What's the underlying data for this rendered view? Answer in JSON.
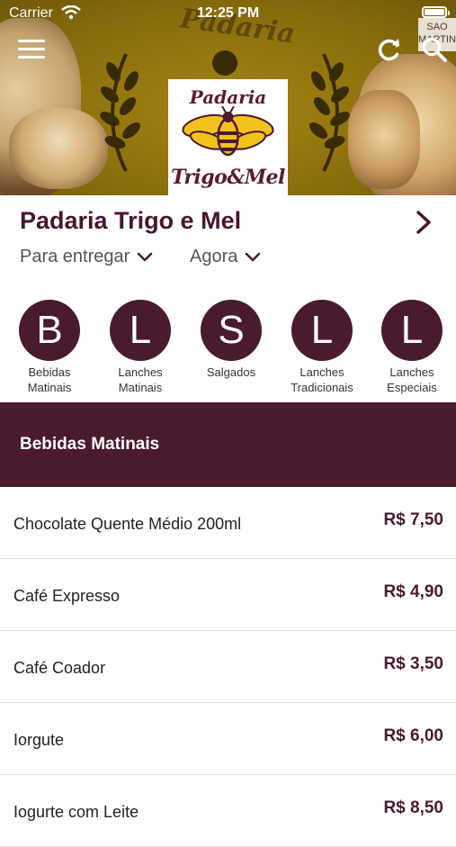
{
  "status_bar": {
    "carrier": "Carrier",
    "time": "12:25 PM"
  },
  "hero": {
    "background_word": "Padaria",
    "sign_lines": [
      "SAO",
      "MARTIN"
    ]
  },
  "logo": {
    "line1": "Padaria",
    "line2": "Trigo&Mel"
  },
  "store": {
    "name": "Padaria Trigo e Mel",
    "delivery_mode": "Para entregar",
    "schedule": "Agora"
  },
  "categories": [
    {
      "letter": "B",
      "label_lines": [
        "Bebidas",
        "Matinais"
      ]
    },
    {
      "letter": "L",
      "label_lines": [
        "Lanches",
        "Matinais"
      ]
    },
    {
      "letter": "S",
      "label_lines": [
        "Salgados",
        ""
      ]
    },
    {
      "letter": "L",
      "label_lines": [
        "Lanches",
        "Tradicionais"
      ]
    },
    {
      "letter": "L",
      "label_lines": [
        "Lanches",
        "Especiais"
      ]
    }
  ],
  "section": {
    "title": "Bebidas Matinais"
  },
  "items": [
    {
      "name": "Chocolate Quente Médio 200ml",
      "price": "R$ 7,50"
    },
    {
      "name": "Café Expresso",
      "price": "R$ 4,90"
    },
    {
      "name": "Café Coador",
      "price": "R$ 3,50"
    },
    {
      "name": "Iorgute",
      "price": "R$ 6,00"
    },
    {
      "name": "Iogurte com Leite",
      "price": "R$ 8,50"
    }
  ],
  "colors": {
    "brand": "#4a1a2f",
    "hero_gold": "#8a6e0c",
    "bee_yellow": "#f2c21b"
  },
  "icons": [
    "wifi-icon",
    "battery-icon",
    "menu-icon",
    "refresh-icon",
    "search-icon",
    "chevron-right-icon",
    "chevron-down-icon",
    "bee-icon",
    "wreath-icon"
  ]
}
